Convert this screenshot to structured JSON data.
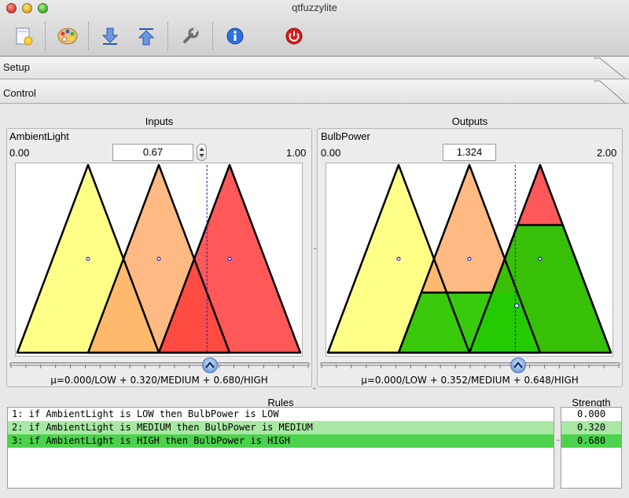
{
  "window": {
    "title": "qtfuzzylite"
  },
  "toolbar": {
    "items": [
      {
        "name": "new-icon"
      },
      {
        "name": "palette-icon"
      },
      {
        "name": "import-icon"
      },
      {
        "name": "export-icon"
      },
      {
        "name": "wrench-icon"
      },
      {
        "name": "info-icon"
      },
      {
        "name": "power-icon"
      }
    ]
  },
  "sections": {
    "setup": "Setup",
    "control": "Control"
  },
  "inputs": {
    "group_title": "Inputs",
    "variable": "AmbientLight",
    "min": "0.00",
    "max": "1.00",
    "value": "0.67",
    "value_fraction": 0.67,
    "membership": "μ=0.000/LOW + 0.320/MEDIUM + 0.680/HIGH",
    "terms": [
      {
        "name": "LOW",
        "a": 0.0,
        "b": 0.25,
        "c": 0.5,
        "degree": 0.0
      },
      {
        "name": "MEDIUM",
        "a": 0.25,
        "b": 0.5,
        "c": 0.75,
        "degree": 0.32
      },
      {
        "name": "HIGH",
        "a": 0.5,
        "b": 0.75,
        "c": 1.0,
        "degree": 0.68
      }
    ]
  },
  "outputs": {
    "group_title": "Outputs",
    "variable": "BulbPower",
    "min": "0.00",
    "max": "2.00",
    "value": "1.324",
    "value_fraction": 0.662,
    "membership": "μ=0.000/LOW + 0.352/MEDIUM + 0.648/HIGH",
    "terms": [
      {
        "name": "LOW",
        "a": 0.0,
        "b": 0.5,
        "c": 1.0,
        "activation": 0.0
      },
      {
        "name": "MEDIUM",
        "a": 0.5,
        "b": 1.0,
        "c": 1.5,
        "activation": 0.32
      },
      {
        "name": "HIGH",
        "a": 1.0,
        "b": 1.5,
        "c": 2.0,
        "activation": 0.68
      }
    ]
  },
  "rules": {
    "title": "Rules",
    "strength_title": "Strength",
    "items": [
      {
        "text": "1: if AmbientLight is LOW then BulbPower is LOW",
        "strength": "0.000",
        "bg": "#ffffff"
      },
      {
        "text": "2: if AmbientLight is MEDIUM then BulbPower is MEDIUM",
        "strength": "0.320",
        "bg": "#a8e8a4"
      },
      {
        "text": "3: if AmbientLight is HIGH then BulbPower is HIGH",
        "strength": "0.680",
        "bg": "#4cd24c"
      }
    ]
  },
  "colors": {
    "low": "#ffff88",
    "medium": "#ffaa66",
    "high": "#ff3333",
    "activated": "#22cc00",
    "overlap_low_medium": "#ffb033",
    "overlap_medium_high": "#ff2a00"
  }
}
